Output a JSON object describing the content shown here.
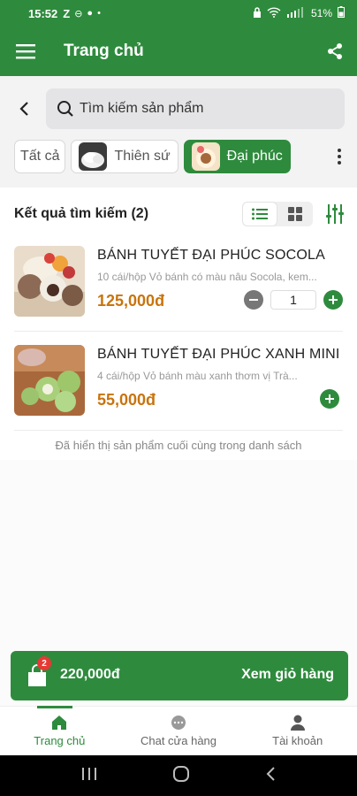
{
  "status_bar": {
    "time": "15:52",
    "battery": "51%"
  },
  "app_bar": {
    "title": "Trang chủ"
  },
  "search": {
    "placeholder": "Tìm kiếm sản phẩm"
  },
  "categories": [
    {
      "label": "Tất cả",
      "active": false
    },
    {
      "label": "Thiên sứ",
      "active": false
    },
    {
      "label": "Đại phúc",
      "active": true
    }
  ],
  "results": {
    "title": "Kết quả tìm kiếm (2)"
  },
  "products": [
    {
      "name": "BÁNH TUYẾT ĐẠI PHÚC SOCOLA",
      "description": "10 cái/hộp Vỏ bánh có màu nâu Socola, kem...",
      "price": "125,000đ",
      "quantity": "1"
    },
    {
      "name": "BÁNH TUYẾT ĐẠI PHÚC XANH MINI",
      "description": "4 cái/hộp Vỏ bánh màu xanh thơm vị Trà...",
      "price": "55,000đ"
    }
  ],
  "end_of_list": "Đã hiển thị sản phẩm cuối cùng trong danh sách",
  "cart": {
    "count": "2",
    "total": "220,000đ",
    "action": "Xem giỏ hàng"
  },
  "bottom_nav": [
    {
      "label": "Trang chủ",
      "icon": "home-icon",
      "active": true
    },
    {
      "label": "Chat cửa hàng",
      "icon": "chat-icon",
      "active": false
    },
    {
      "label": "Tài khoản",
      "icon": "user-icon",
      "active": false
    }
  ],
  "colors": {
    "primary": "#2e8b3d",
    "price": "#c8740e",
    "badge": "#e53935"
  }
}
